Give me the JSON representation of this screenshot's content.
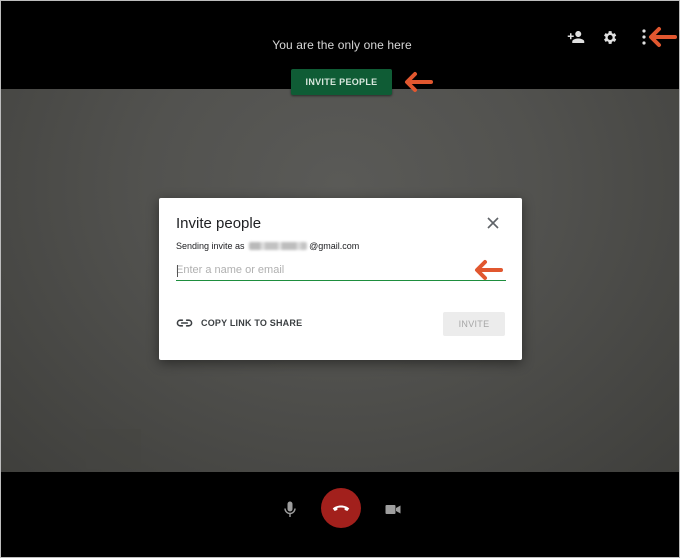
{
  "topbar": {
    "status_text": "You are the only one here",
    "invite_button_label": "INVITE PEOPLE",
    "icons": [
      "add-person-icon",
      "gear-icon",
      "more-vert-icon"
    ]
  },
  "dialog": {
    "title": "Invite people",
    "sending_prefix": "Sending invite as",
    "sending_email_suffix": "@gmail.com",
    "input_placeholder": "Enter a name or email",
    "input_value": "",
    "copy_link_label": "COPY LINK TO SHARE",
    "invite_button_label": "INVITE",
    "invite_button_disabled": true
  },
  "bottombar": {
    "icons": [
      "microphone-icon",
      "hang-up-icon",
      "camera-icon"
    ]
  },
  "colors": {
    "accent_green": "#0f5c35",
    "input_underline": "#1e8e3e",
    "hangup_red": "#a2201c",
    "annotation_arrow": "#e1572f"
  }
}
